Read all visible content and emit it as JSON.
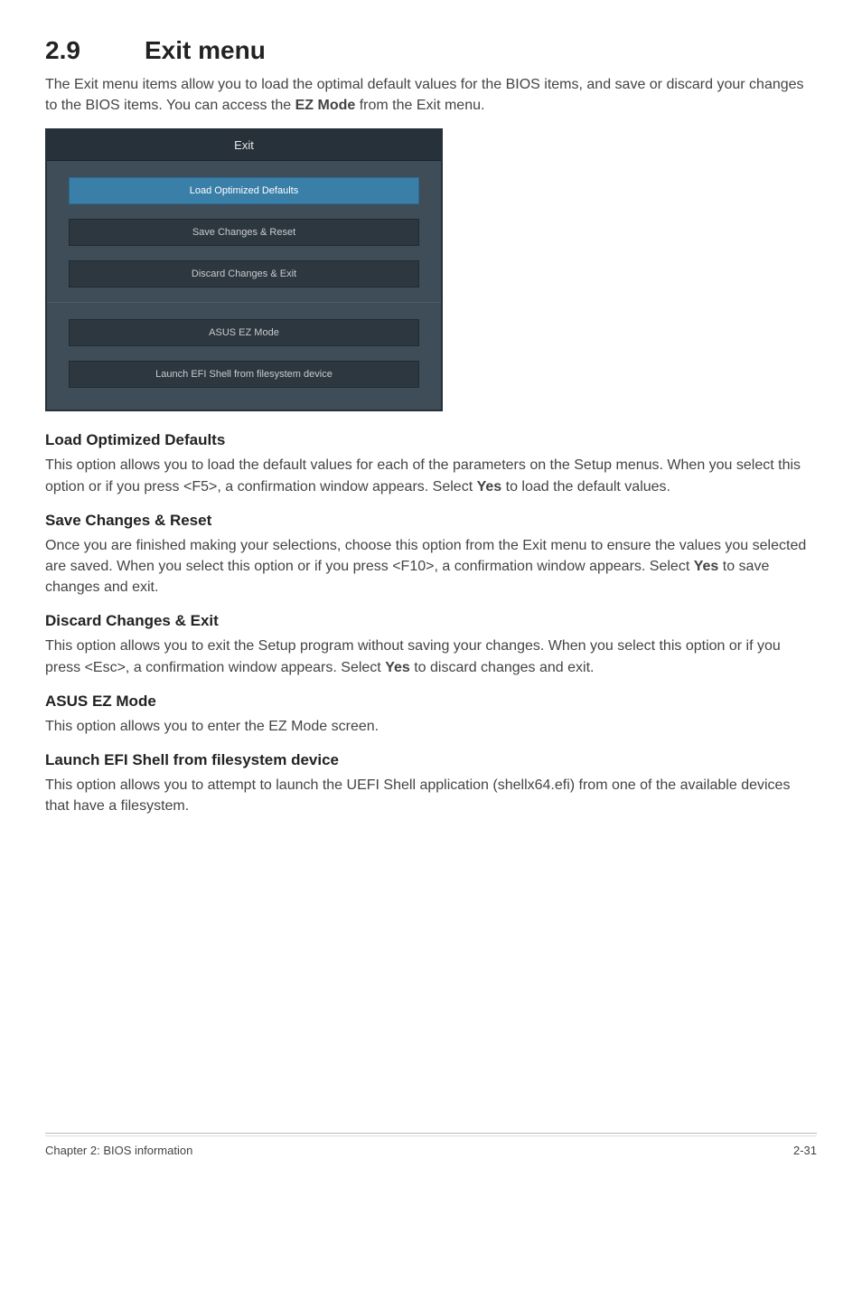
{
  "section": {
    "number": "2.9",
    "title": "Exit menu",
    "intro_pre": "The Exit menu items allow you to load the optimal default values for the BIOS items, and save or discard your changes to the BIOS items. You can access the ",
    "intro_bold": "EZ Mode",
    "intro_post": " from the Exit menu."
  },
  "bios": {
    "header": "Exit",
    "buttons_top": [
      {
        "label": "Load Optimized Defaults",
        "selected": true
      },
      {
        "label": "Save Changes & Reset",
        "selected": false
      },
      {
        "label": "Discard Changes & Exit",
        "selected": false
      }
    ],
    "buttons_bottom": [
      {
        "label": "ASUS EZ Mode",
        "selected": false
      },
      {
        "label": "Launch EFI Shell from filesystem device",
        "selected": false
      }
    ]
  },
  "subsections": [
    {
      "heading": "Load Optimized Defaults",
      "p_pre": "This option allows you to load the default values for each of the parameters on the Setup menus. When you select this option or if you press <F5>, a confirmation window appears. Select ",
      "p_bold": "Yes",
      "p_post": " to load the default values."
    },
    {
      "heading": "Save Changes & Reset",
      "p_pre": "Once you are finished making your selections, choose this option from the Exit menu to ensure the values you selected are saved. When you select this option or if you press <F10>, a confirmation window appears. Select ",
      "p_bold": "Yes",
      "p_post": " to save changes and exit."
    },
    {
      "heading": "Discard Changes & Exit",
      "p_pre": "This option allows you to exit the Setup program without saving your changes. When you select this option or if you press <Esc>, a confirmation window appears. Select ",
      "p_bold": "Yes",
      "p_post": " to discard changes and exit."
    },
    {
      "heading": "ASUS EZ Mode",
      "p_pre": "This option allows you to enter the EZ Mode screen.",
      "p_bold": "",
      "p_post": ""
    },
    {
      "heading": "Launch EFI Shell from filesystem device",
      "p_pre": "This option allows you to attempt to launch the UEFI Shell application (shellx64.efi) from one of the available devices that have a filesystem.",
      "p_bold": "",
      "p_post": ""
    }
  ],
  "footer": {
    "left": "Chapter 2: BIOS information",
    "right": "2-31"
  }
}
